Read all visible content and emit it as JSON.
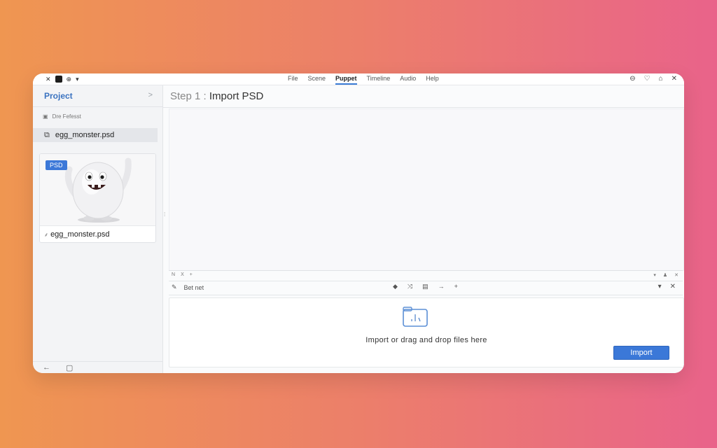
{
  "menu": {
    "items": [
      "File",
      "Scene",
      "Puppet",
      "Timeline",
      "Audio",
      "Help"
    ],
    "active": "Puppet"
  },
  "sidebar": {
    "title": "Project",
    "recent_label": "Dre Fefesst",
    "file_name": "egg_monster.psd",
    "thumbnail": {
      "badge": "PSD",
      "label": "egg_monster.psd"
    }
  },
  "main": {
    "step_prefix": "Step 1 :",
    "step_title": "Import PSD",
    "tabstrip_left": [
      "N",
      "X",
      "+"
    ],
    "toolbar_label": "Bet net",
    "drop_text": "Import or drag and drop files here",
    "import_button": "Import"
  },
  "colors": {
    "accent": "#3b78d8",
    "sidebar_title": "#3b73c0"
  }
}
